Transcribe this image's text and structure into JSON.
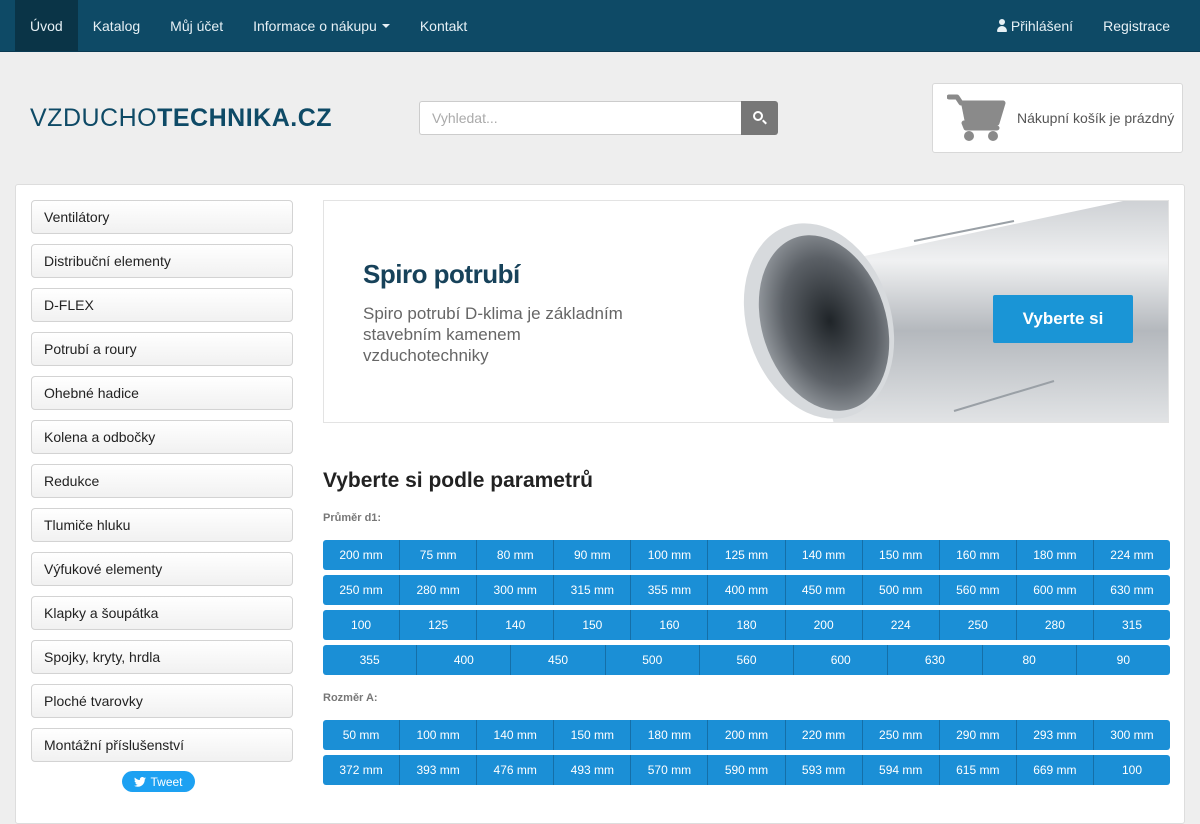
{
  "nav": {
    "left": [
      {
        "label": "Úvod",
        "active": true
      },
      {
        "label": "Katalog"
      },
      {
        "label": "Můj účet"
      },
      {
        "label": "Informace o nákupu",
        "dropdown": true
      },
      {
        "label": "Kontakt"
      }
    ],
    "login_label": "Přihlášení",
    "register_label": "Registrace"
  },
  "logo": {
    "part1": "VZDUCHO",
    "part2": "TECHNIKA.CZ"
  },
  "search": {
    "placeholder": "Vyhledat..."
  },
  "cart": {
    "text": "Nákupní košík je prázdný"
  },
  "sidebar": {
    "categories": [
      "Ventilátory",
      "Distribuční elementy",
      "D-FLEX",
      "Potrubí a roury",
      "Ohebné hadice",
      "Kolena a odbočky",
      "Redukce",
      "Tlumiče hluku",
      "Výfukové elementy",
      "Klapky a šoupátka",
      "Spojky, kryty, hrdla",
      "Ploché tvarovky",
      "Montážní příslušenství"
    ],
    "tweet_label": "Tweet"
  },
  "banner": {
    "title": "Spiro potrubí",
    "text": "Spiro potrubí D-klima je základním stavebním kamenem vzduchotechniky",
    "button": "Vyberte si"
  },
  "params": {
    "title": "Vyberte si podle parametrů",
    "groups": [
      {
        "label": "Průměr d1:",
        "rows": [
          [
            "200 mm",
            "75 mm",
            "80 mm",
            "90 mm",
            "100 mm",
            "125 mm",
            "140 mm",
            "150 mm",
            "160 mm",
            "180 mm",
            "224 mm"
          ],
          [
            "250 mm",
            "280 mm",
            "300 mm",
            "315 mm",
            "355 mm",
            "400 mm",
            "450 mm",
            "500 mm",
            "560 mm",
            "600 mm",
            "630 mm"
          ],
          [
            "100",
            "125",
            "140",
            "150",
            "160",
            "180",
            "200",
            "224",
            "250",
            "280",
            "315"
          ],
          [
            "355",
            "400",
            "450",
            "500",
            "560",
            "600",
            "630",
            "80",
            "90"
          ]
        ]
      },
      {
        "label": "Rozměr A:",
        "rows": [
          [
            "50 mm",
            "100 mm",
            "140 mm",
            "150 mm",
            "180 mm",
            "200 mm",
            "220 mm",
            "250 mm",
            "290 mm",
            "293 mm",
            "300 mm"
          ],
          [
            "372 mm",
            "393 mm",
            "476 mm",
            "493 mm",
            "570 mm",
            "590 mm",
            "593 mm",
            "594 mm",
            "615 mm",
            "669 mm",
            "100"
          ]
        ]
      }
    ]
  },
  "colors": {
    "navbar": "#0e4a66",
    "accent": "#1b8fd6",
    "tweet": "#1da1f2"
  }
}
